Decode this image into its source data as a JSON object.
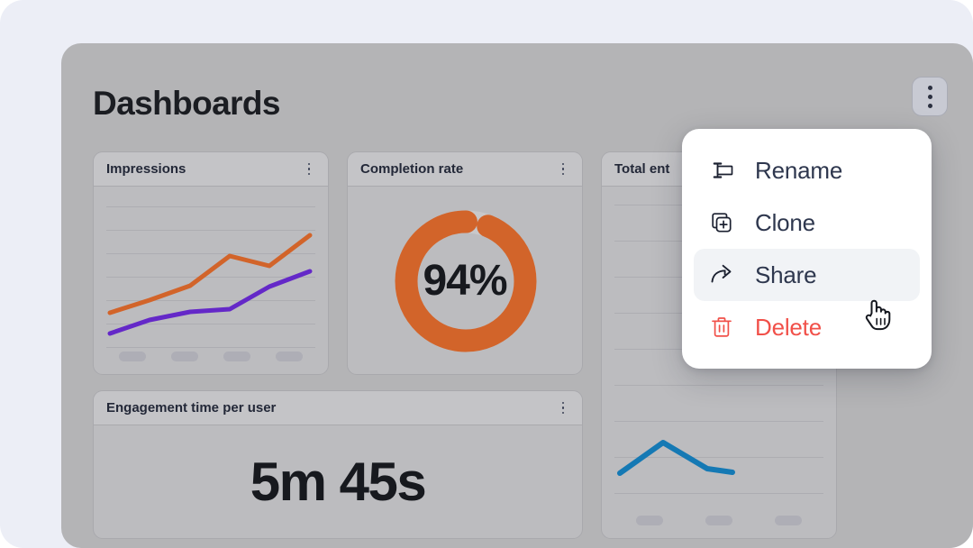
{
  "page": {
    "title": "Dashboards",
    "background_color": "#eceef6",
    "panel_color": "#b4b4b6"
  },
  "header": {
    "title": "Dashboards",
    "menu_button_icon": "kebab-menu-icon"
  },
  "cards": [
    {
      "id": "impressions",
      "title": "Impressions",
      "kebab_icon": "kebab-menu-icon",
      "type": "line-chart"
    },
    {
      "id": "completion",
      "title": "Completion rate",
      "kebab_icon": "kebab-menu-icon",
      "type": "donut-chart",
      "value": "94%"
    },
    {
      "id": "total",
      "title": "Total ent",
      "kebab_icon": "kebab-menu-icon",
      "type": "line-chart"
    },
    {
      "id": "engagement",
      "title": "Engagement time per user",
      "kebab_icon": "kebab-menu-icon",
      "type": "stat",
      "value": "5m 45s"
    }
  ],
  "context_menu": {
    "items": [
      {
        "label": "Rename",
        "icon": "rename-icon",
        "state": "normal",
        "color": "#2e374e"
      },
      {
        "label": "Clone",
        "icon": "clone-icon",
        "state": "normal",
        "color": "#2e374e"
      },
      {
        "label": "Share",
        "icon": "share-icon",
        "state": "highlighted",
        "color": "#2e374e"
      },
      {
        "label": "Delete",
        "icon": "trash-icon",
        "state": "danger",
        "color": "#f15049"
      }
    ]
  },
  "cursor": {
    "icon": "pointing-hand-cursor"
  },
  "chart_data": [
    {
      "id": "impressions",
      "type": "line",
      "title": "Impressions",
      "x": [
        0,
        1,
        2,
        3,
        4,
        5
      ],
      "series": [
        {
          "name": "orange-series",
          "color": "#d2642a",
          "values": [
            34,
            42,
            48,
            64,
            60,
            78
          ]
        },
        {
          "name": "purple-series",
          "color": "#6428c8",
          "values": [
            22,
            30,
            35,
            37,
            50,
            60
          ]
        }
      ],
      "xlabel": "",
      "ylabel": "",
      "ylim": [
        0,
        100
      ],
      "grid": true,
      "legend": "none",
      "tick_placeholders": 4
    },
    {
      "id": "completion",
      "type": "pie",
      "title": "Completion rate",
      "labels": [
        "Completed",
        "Remaining"
      ],
      "values": [
        94,
        6
      ],
      "colors": [
        "#d2642a",
        "#c8c8ca"
      ],
      "center_label": "94%",
      "donut": true
    },
    {
      "id": "total",
      "type": "line",
      "title": "Total ent",
      "x": [
        0,
        1,
        2,
        3
      ],
      "series": [
        {
          "name": "blue-series",
          "color": "#1579b4",
          "values": [
            44,
            56,
            50,
            42
          ]
        }
      ],
      "xlabel": "",
      "ylabel": "",
      "ylim": [
        0,
        100
      ],
      "grid": true,
      "legend": "none",
      "tick_placeholders": 3
    },
    {
      "id": "engagement",
      "type": "table",
      "title": "Engagement time per user",
      "categories": [
        "Engagement time per user"
      ],
      "values": [
        "5m 45s"
      ]
    }
  ]
}
